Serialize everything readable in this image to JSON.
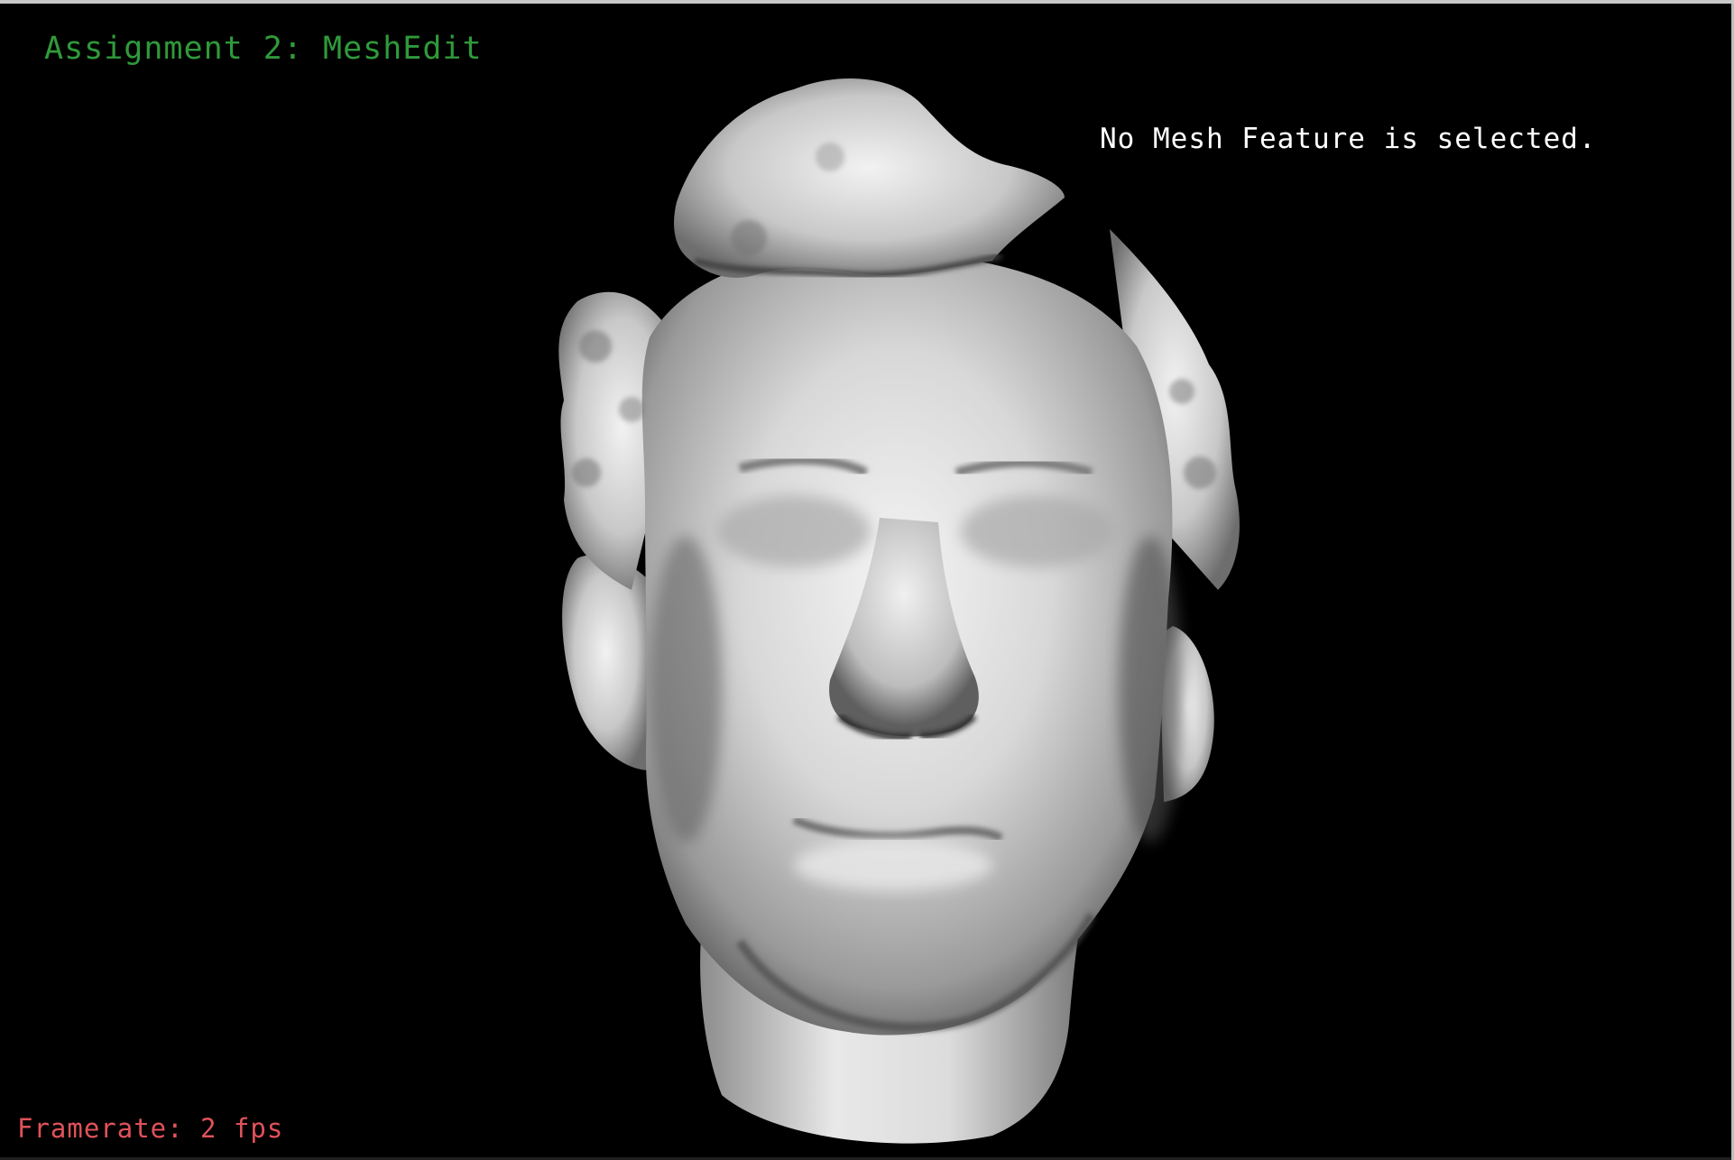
{
  "window": {
    "title": "Assignment 2: MeshEdit"
  },
  "viewport": {
    "model": "human head mesh",
    "background_color": "#000000",
    "mesh_color": "#d9d9d9"
  },
  "overlay": {
    "status": "No Mesh Feature is selected.",
    "framerate_label": "Framerate: 2 fps"
  },
  "colors": {
    "title": "#2f9a3a",
    "status": "#ffffff",
    "framerate": "#e0525a"
  }
}
